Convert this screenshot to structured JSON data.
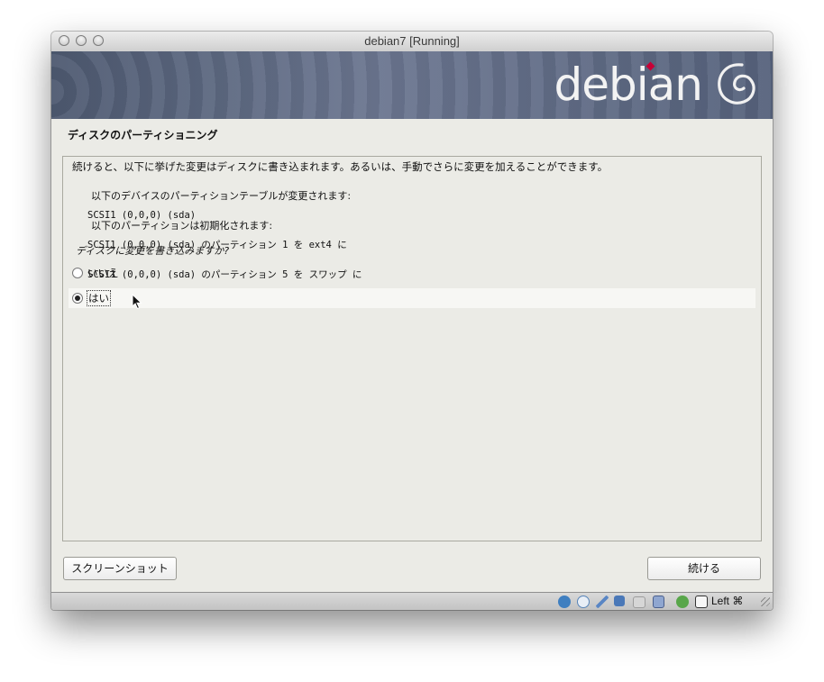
{
  "window": {
    "title": "debian7 [Running]"
  },
  "banner": {
    "brand": "debian"
  },
  "installer": {
    "step_title": "ディスクのパーティショニング",
    "description": "続けると、以下に挙げた変更はディスクに書き込まれます。あるいは、手動でさらに変更を加えることができます。",
    "table_heading": "以下のデバイスのパーティションテーブルが変更されます:",
    "table_item": "SCSI1 (0,0,0) (sda)",
    "format_heading": "以下のパーティションは初期化されます:",
    "format_item_1": "SCSI1 (0,0,0) (sda) のパーティション 1 を ext4 に",
    "format_item_2": "SCSI1 (0,0,0) (sda) のパーティション 5 を スワップ に",
    "question": "ディスクに変更を書き込みますか?",
    "options": [
      {
        "label": "いいえ",
        "selected": false
      },
      {
        "label": "はい",
        "selected": true
      }
    ],
    "screenshot_button": "スクリーンショット",
    "continue_button": "続ける"
  },
  "statusbar": {
    "host_key": "Left ⌘",
    "icons": [
      "hard-disk-icon",
      "optical-drive-icon",
      "pencil-icon",
      "network-icon",
      "folder-icon",
      "display-icon",
      "usb-icon",
      "mouse-integration-icon"
    ]
  },
  "colors": {
    "banner": "#5f6a82",
    "accent": "#c70036",
    "panel": "#ebebe6"
  }
}
